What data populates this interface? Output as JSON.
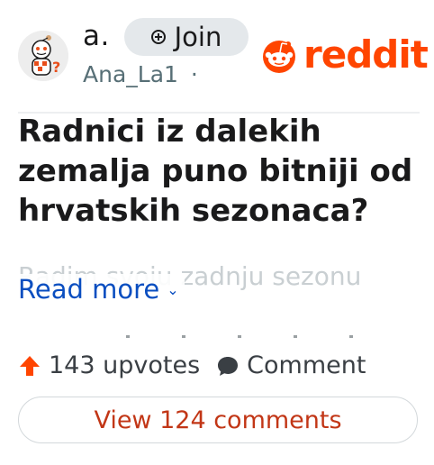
{
  "post": {
    "subreddit": "a.",
    "join_label": "Join",
    "username": "Ana_La1",
    "separator": "·",
    "brand": "reddit",
    "title": "Radnici iz dalekih zemalja puno bitniji od hrvatskih sezonaca?",
    "body_preview": "Radim svoju zadnju sezonu",
    "read_more": "Read more",
    "upvotes": "143 upvotes",
    "comment_label": "Comment",
    "view_comments": "View 124 comments"
  },
  "colors": {
    "brand": "#ff4500",
    "link": "#0a4ec0",
    "view_comments": "#c23616"
  },
  "icons": {
    "join": "plus-circle-icon",
    "read_more": "chevron-down-icon",
    "upvote": "upvote-arrow-icon",
    "comment": "comment-bubble-icon"
  }
}
